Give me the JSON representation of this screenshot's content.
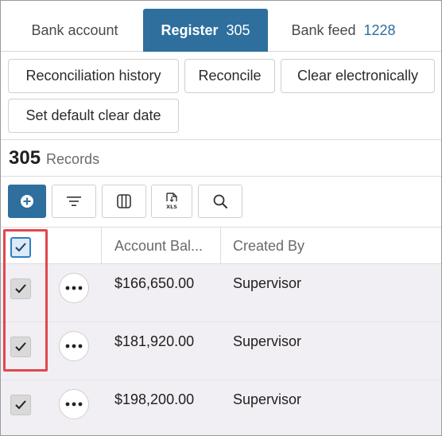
{
  "tabs": [
    {
      "label": "Bank account",
      "count": ""
    },
    {
      "label": "Register",
      "count": "305"
    },
    {
      "label": "Bank feed",
      "count": "1228"
    }
  ],
  "actions": {
    "reconciliation_history": "Reconciliation history",
    "reconcile": "Reconcile",
    "clear_electronically": "Clear electronically",
    "set_default_clear_date": "Set default clear date"
  },
  "records": {
    "count": "305",
    "label": "Records"
  },
  "toolbar_icons": [
    "add-icon",
    "filter-icon",
    "columns-icon",
    "xls-export-icon",
    "search-icon"
  ],
  "columns": {
    "account_balance": "Account Bal...",
    "created_by": "Created By"
  },
  "rows": [
    {
      "checked": true,
      "account_balance": "$166,650.00",
      "created_by": "Supervisor"
    },
    {
      "checked": true,
      "account_balance": "$181,920.00",
      "created_by": "Supervisor"
    },
    {
      "checked": true,
      "account_balance": "$198,200.00",
      "created_by": "Supervisor"
    }
  ],
  "colors": {
    "accent": "#2e6f9e",
    "highlight": "#e0474c",
    "row_bg": "#f1eff3"
  }
}
